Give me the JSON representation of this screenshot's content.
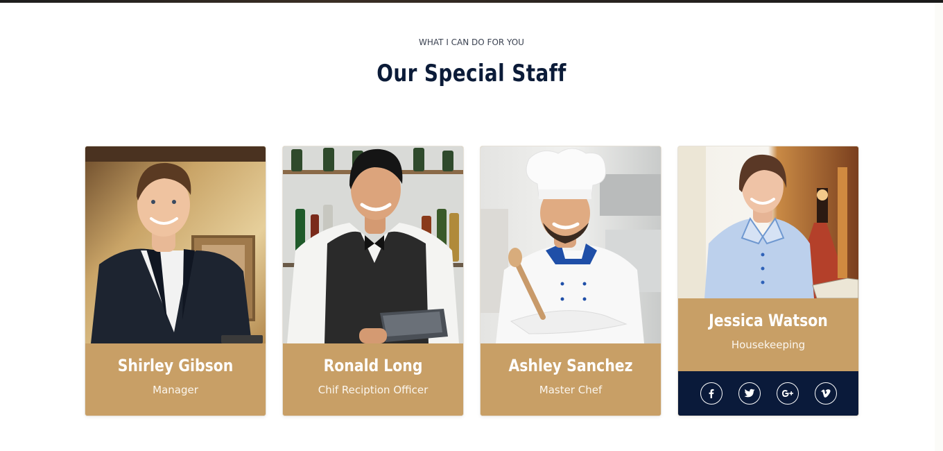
{
  "section": {
    "eyebrow": "WHAT I CAN DO FOR YOU",
    "title": "Our Special Staff"
  },
  "staff": [
    {
      "name": "Shirley Gibson",
      "role": "Manager",
      "photo": "manager-photo"
    },
    {
      "name": "Ronald Long",
      "role": "Chif Reciption Officer",
      "photo": "waiter-photo"
    },
    {
      "name": "Ashley Sanchez",
      "role": "Master Chef",
      "photo": "chef-photo"
    },
    {
      "name": "Jessica Watson",
      "role": "Housekeeping",
      "photo": "housekeeper-photo",
      "social": [
        "facebook-icon",
        "twitter-icon",
        "google-plus-icon",
        "vimeo-icon"
      ]
    }
  ],
  "colors": {
    "accent": "#c89f66",
    "navy": "#0a1a3a",
    "title": "#0b1b38"
  }
}
